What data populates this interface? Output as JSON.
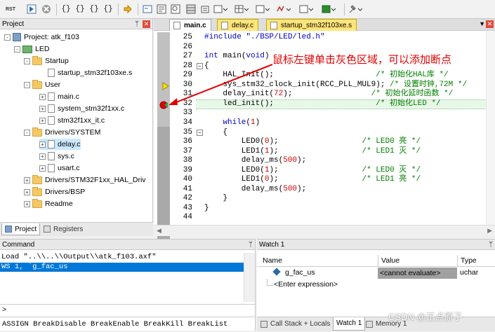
{
  "toolbar": {
    "rst_label": "RST",
    "icons": [
      "rst-icon",
      "stop-icon",
      "step-into-icon",
      "step-over-icon",
      "step-out-icon",
      "run-to-cursor-icon",
      "show-next-statement-icon",
      "command-window-icon",
      "disassembly-window-icon",
      "symbols-window-icon",
      "registers-window-icon",
      "call-stack-window-icon",
      "watch-window-icon",
      "memory-window-icon",
      "serial-window-icon",
      "analysis-window-icon",
      "trace-window-icon",
      "system-viewer-icon",
      "toolbox-icon"
    ]
  },
  "project_panel": {
    "title": "Project",
    "tree": [
      {
        "label": "Project: atk_f103",
        "kind": "project",
        "expander": "-"
      },
      {
        "label": "LED",
        "kind": "target",
        "expander": "-"
      },
      {
        "label": "Startup",
        "kind": "folder",
        "expander": "-"
      },
      {
        "label": "startup_stm32f103xe.s",
        "kind": "file",
        "expander": ""
      },
      {
        "label": "User",
        "kind": "folder",
        "expander": "-"
      },
      {
        "label": "main.c",
        "kind": "file",
        "expander": "+"
      },
      {
        "label": "system_stm32f1xx.c",
        "kind": "file",
        "expander": "+"
      },
      {
        "label": "stm32f1xx_it.c",
        "kind": "file",
        "expander": "+"
      },
      {
        "label": "Drivers/SYSTEM",
        "kind": "folder",
        "expander": "-"
      },
      {
        "label": "delay.c",
        "kind": "file",
        "expander": "+",
        "selected": true
      },
      {
        "label": "sys.c",
        "kind": "file",
        "expander": "+"
      },
      {
        "label": "usart.c",
        "kind": "file",
        "expander": "+"
      },
      {
        "label": "Drivers/STM32F1xx_HAL_Driv",
        "kind": "folder",
        "expander": "+"
      },
      {
        "label": "Drivers/BSP",
        "kind": "folder",
        "expander": "+"
      },
      {
        "label": "Readme",
        "kind": "folder",
        "expander": "+"
      }
    ],
    "tabs": [
      "Project",
      "Registers"
    ]
  },
  "editor": {
    "tabs": [
      {
        "label": "main.c",
        "active": true
      },
      {
        "label": "delay.c",
        "active": false
      },
      {
        "label": "startup_stm32f103xe.s",
        "active": false
      }
    ],
    "annotation": "鼠标左键单击灰色区域，可以添加断点",
    "lines": [
      {
        "n": "25",
        "parts": [
          {
            "t": "#include \"./BSP/LED/led.h\"",
            "c": "kw"
          }
        ]
      },
      {
        "n": "26",
        "parts": []
      },
      {
        "n": "27",
        "parts": [
          {
            "t": "int",
            "c": "kw"
          },
          {
            "t": " main("
          },
          {
            "t": "void",
            "c": "kw"
          },
          {
            "t": ")"
          }
        ]
      },
      {
        "n": "28",
        "parts": [
          {
            "t": "{"
          }
        ]
      },
      {
        "n": "29",
        "parts": [
          {
            "t": "    HAL_Init();                      "
          },
          {
            "t": "/* 初始化HAL库 */",
            "c": "cm"
          }
        ]
      },
      {
        "n": "30",
        "parts": [
          {
            "t": "    sys_stm32_clock_init(RCC_PLL_MUL9); "
          },
          {
            "t": "/* 设置时钟,72M */",
            "c": "cm"
          }
        ]
      },
      {
        "n": "31",
        "parts": [
          {
            "t": "    delay_init("
          },
          {
            "t": "72",
            "c": "num"
          },
          {
            "t": ");                 "
          },
          {
            "t": "/* 初始化延时函数 */",
            "c": "cm"
          }
        ]
      },
      {
        "n": "32",
        "parts": [
          {
            "t": "    led_init();                      "
          },
          {
            "t": "/* 初始化LED */",
            "c": "cm"
          }
        ]
      },
      {
        "n": "33",
        "parts": []
      },
      {
        "n": "34",
        "parts": [
          {
            "t": "    "
          },
          {
            "t": "while",
            "c": "kw"
          },
          {
            "t": "("
          },
          {
            "t": "1",
            "c": "num"
          },
          {
            "t": ")"
          }
        ]
      },
      {
        "n": "35",
        "parts": [
          {
            "t": "    {"
          }
        ]
      },
      {
        "n": "36",
        "parts": [
          {
            "t": "        LED0("
          },
          {
            "t": "0",
            "c": "num"
          },
          {
            "t": ");                  "
          },
          {
            "t": "/* LED0 亮 */",
            "c": "cm"
          }
        ]
      },
      {
        "n": "37",
        "parts": [
          {
            "t": "        LED1("
          },
          {
            "t": "1",
            "c": "num"
          },
          {
            "t": ");                  "
          },
          {
            "t": "/* LED1 灭 */",
            "c": "cm"
          }
        ]
      },
      {
        "n": "38",
        "parts": [
          {
            "t": "        delay_ms("
          },
          {
            "t": "500",
            "c": "num"
          },
          {
            "t": ");"
          }
        ]
      },
      {
        "n": "39",
        "parts": [
          {
            "t": "        LED0("
          },
          {
            "t": "1",
            "c": "num"
          },
          {
            "t": ");                  "
          },
          {
            "t": "/* LED0 灭 */",
            "c": "cm"
          }
        ]
      },
      {
        "n": "40",
        "parts": [
          {
            "t": "        LED1("
          },
          {
            "t": "0",
            "c": "num"
          },
          {
            "t": ");                  "
          },
          {
            "t": "/* LED1 亮 */",
            "c": "cm"
          }
        ]
      },
      {
        "n": "41",
        "parts": [
          {
            "t": "        delay_ms("
          },
          {
            "t": "500",
            "c": "num"
          },
          {
            "t": ");"
          }
        ]
      },
      {
        "n": "42",
        "parts": [
          {
            "t": "    }"
          }
        ]
      },
      {
        "n": "43",
        "parts": [
          {
            "t": "}"
          }
        ]
      },
      {
        "n": "44",
        "parts": []
      }
    ]
  },
  "command_panel": {
    "title": "Command",
    "lines": [
      "Load \"..\\\\..\\\\Output\\\\atk_f103.axf\"",
      "WS 1, `g_fac_us"
    ],
    "prompt": ">",
    "help": "ASSIGN BreakDisable BreakEnable BreakKill BreakList"
  },
  "watch_panel": {
    "title": "Watch 1",
    "columns": [
      "Name",
      "Value",
      "Type"
    ],
    "rows": [
      {
        "name": "g_fac_us",
        "value": "<cannot evaluate>",
        "type": "uchar"
      },
      {
        "name": "<Enter expression>",
        "value": "",
        "type": ""
      }
    ],
    "tabs": [
      "Call Stack + Locals",
      "Watch 1",
      "Memory 1"
    ]
  },
  "watermark": "CSDN @正点原子",
  "colors": {
    "comment": "#008000",
    "keyword": "#0000c8",
    "number": "#c80000",
    "annotation": "#e00000",
    "breakpoint": "#e00000",
    "selection": "#0078d7",
    "gutter": "#c0c0c0",
    "current_line": "#e8f8e8"
  }
}
